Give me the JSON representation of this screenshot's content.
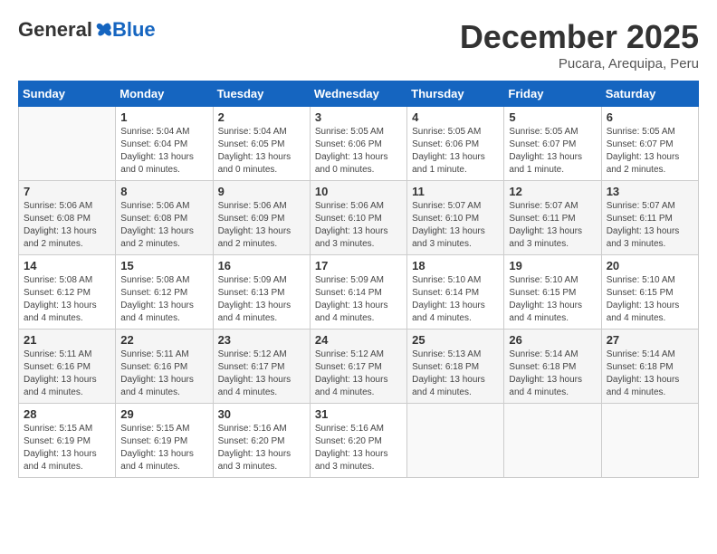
{
  "header": {
    "logo_general": "General",
    "logo_blue": "Blue",
    "month_title": "December 2025",
    "location": "Pucara, Arequipa, Peru"
  },
  "days_of_week": [
    "Sunday",
    "Monday",
    "Tuesday",
    "Wednesday",
    "Thursday",
    "Friday",
    "Saturday"
  ],
  "weeks": [
    [
      {
        "day": "",
        "info": ""
      },
      {
        "day": "1",
        "info": "Sunrise: 5:04 AM\nSunset: 6:04 PM\nDaylight: 13 hours\nand 0 minutes."
      },
      {
        "day": "2",
        "info": "Sunrise: 5:04 AM\nSunset: 6:05 PM\nDaylight: 13 hours\nand 0 minutes."
      },
      {
        "day": "3",
        "info": "Sunrise: 5:05 AM\nSunset: 6:06 PM\nDaylight: 13 hours\nand 0 minutes."
      },
      {
        "day": "4",
        "info": "Sunrise: 5:05 AM\nSunset: 6:06 PM\nDaylight: 13 hours\nand 1 minute."
      },
      {
        "day": "5",
        "info": "Sunrise: 5:05 AM\nSunset: 6:07 PM\nDaylight: 13 hours\nand 1 minute."
      },
      {
        "day": "6",
        "info": "Sunrise: 5:05 AM\nSunset: 6:07 PM\nDaylight: 13 hours\nand 2 minutes."
      }
    ],
    [
      {
        "day": "7",
        "info": "Sunrise: 5:06 AM\nSunset: 6:08 PM\nDaylight: 13 hours\nand 2 minutes."
      },
      {
        "day": "8",
        "info": "Sunrise: 5:06 AM\nSunset: 6:08 PM\nDaylight: 13 hours\nand 2 minutes."
      },
      {
        "day": "9",
        "info": "Sunrise: 5:06 AM\nSunset: 6:09 PM\nDaylight: 13 hours\nand 2 minutes."
      },
      {
        "day": "10",
        "info": "Sunrise: 5:06 AM\nSunset: 6:10 PM\nDaylight: 13 hours\nand 3 minutes."
      },
      {
        "day": "11",
        "info": "Sunrise: 5:07 AM\nSunset: 6:10 PM\nDaylight: 13 hours\nand 3 minutes."
      },
      {
        "day": "12",
        "info": "Sunrise: 5:07 AM\nSunset: 6:11 PM\nDaylight: 13 hours\nand 3 minutes."
      },
      {
        "day": "13",
        "info": "Sunrise: 5:07 AM\nSunset: 6:11 PM\nDaylight: 13 hours\nand 3 minutes."
      }
    ],
    [
      {
        "day": "14",
        "info": "Sunrise: 5:08 AM\nSunset: 6:12 PM\nDaylight: 13 hours\nand 4 minutes."
      },
      {
        "day": "15",
        "info": "Sunrise: 5:08 AM\nSunset: 6:12 PM\nDaylight: 13 hours\nand 4 minutes."
      },
      {
        "day": "16",
        "info": "Sunrise: 5:09 AM\nSunset: 6:13 PM\nDaylight: 13 hours\nand 4 minutes."
      },
      {
        "day": "17",
        "info": "Sunrise: 5:09 AM\nSunset: 6:14 PM\nDaylight: 13 hours\nand 4 minutes."
      },
      {
        "day": "18",
        "info": "Sunrise: 5:10 AM\nSunset: 6:14 PM\nDaylight: 13 hours\nand 4 minutes."
      },
      {
        "day": "19",
        "info": "Sunrise: 5:10 AM\nSunset: 6:15 PM\nDaylight: 13 hours\nand 4 minutes."
      },
      {
        "day": "20",
        "info": "Sunrise: 5:10 AM\nSunset: 6:15 PM\nDaylight: 13 hours\nand 4 minutes."
      }
    ],
    [
      {
        "day": "21",
        "info": "Sunrise: 5:11 AM\nSunset: 6:16 PM\nDaylight: 13 hours\nand 4 minutes."
      },
      {
        "day": "22",
        "info": "Sunrise: 5:11 AM\nSunset: 6:16 PM\nDaylight: 13 hours\nand 4 minutes."
      },
      {
        "day": "23",
        "info": "Sunrise: 5:12 AM\nSunset: 6:17 PM\nDaylight: 13 hours\nand 4 minutes."
      },
      {
        "day": "24",
        "info": "Sunrise: 5:12 AM\nSunset: 6:17 PM\nDaylight: 13 hours\nand 4 minutes."
      },
      {
        "day": "25",
        "info": "Sunrise: 5:13 AM\nSunset: 6:18 PM\nDaylight: 13 hours\nand 4 minutes."
      },
      {
        "day": "26",
        "info": "Sunrise: 5:14 AM\nSunset: 6:18 PM\nDaylight: 13 hours\nand 4 minutes."
      },
      {
        "day": "27",
        "info": "Sunrise: 5:14 AM\nSunset: 6:18 PM\nDaylight: 13 hours\nand 4 minutes."
      }
    ],
    [
      {
        "day": "28",
        "info": "Sunrise: 5:15 AM\nSunset: 6:19 PM\nDaylight: 13 hours\nand 4 minutes."
      },
      {
        "day": "29",
        "info": "Sunrise: 5:15 AM\nSunset: 6:19 PM\nDaylight: 13 hours\nand 4 minutes."
      },
      {
        "day": "30",
        "info": "Sunrise: 5:16 AM\nSunset: 6:20 PM\nDaylight: 13 hours\nand 3 minutes."
      },
      {
        "day": "31",
        "info": "Sunrise: 5:16 AM\nSunset: 6:20 PM\nDaylight: 13 hours\nand 3 minutes."
      },
      {
        "day": "",
        "info": ""
      },
      {
        "day": "",
        "info": ""
      },
      {
        "day": "",
        "info": ""
      }
    ]
  ]
}
